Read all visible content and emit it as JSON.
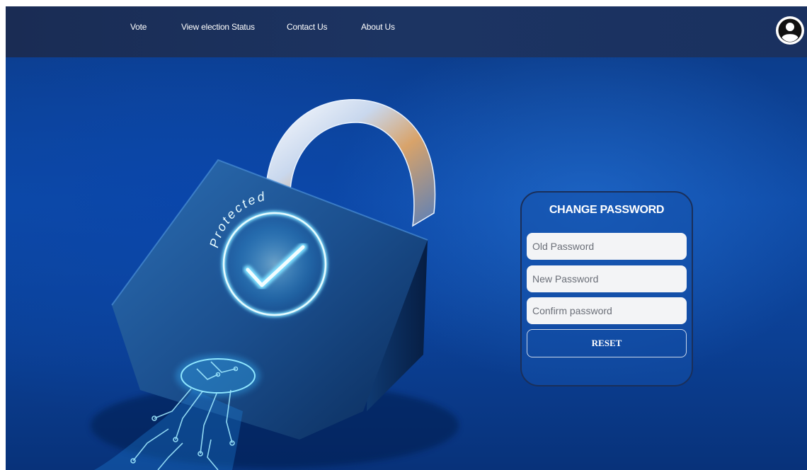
{
  "nav": {
    "items": [
      {
        "label": "Vote"
      },
      {
        "label": "View election Status"
      },
      {
        "label": "Contact Us"
      },
      {
        "label": "About Us"
      }
    ]
  },
  "hero": {
    "padlock_engraving": "Protected"
  },
  "change_password": {
    "title": "CHANGE PASSWORD",
    "old_password": {
      "value": "",
      "placeholder": "Old Password"
    },
    "new_password": {
      "value": "",
      "placeholder": "New Password"
    },
    "confirm_password": {
      "value": "",
      "placeholder": "Confirm password"
    },
    "reset_label": "RESET"
  },
  "colors": {
    "navbar": "#1c3462",
    "background_blue": "#0d4fa8",
    "card_border": "#1a2f5a",
    "glow": "#7fe0ff"
  },
  "icons": {
    "account": "account-circle-icon"
  }
}
